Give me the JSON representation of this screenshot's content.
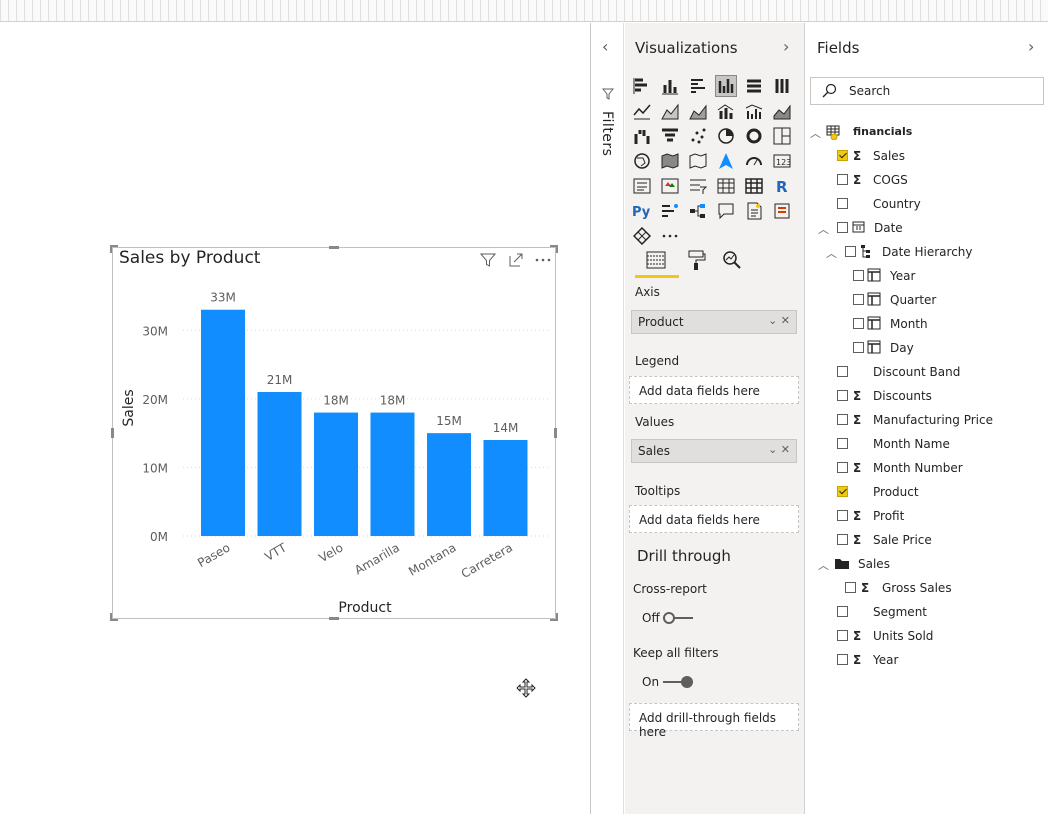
{
  "chart_visual": {
    "title": "Sales by Product",
    "header_icons": [
      "filter-icon",
      "focus-mode-icon",
      "more-options-icon"
    ]
  },
  "chart_data": {
    "type": "bar",
    "title": "Sales by Product",
    "xlabel": "Product",
    "ylabel": "Sales",
    "categories": [
      "Paseo",
      "VTT",
      "Velo",
      "Amarilla",
      "Montana",
      "Carretera"
    ],
    "values": [
      33,
      21,
      18,
      18,
      15,
      14
    ],
    "data_labels": [
      "33M",
      "21M",
      "18M",
      "18M",
      "15M",
      "14M"
    ],
    "y_ticks": [
      "0M",
      "10M",
      "20M",
      "30M"
    ],
    "y_tick_values": [
      0,
      10,
      20,
      30
    ],
    "ylim": [
      0,
      35
    ],
    "bar_color": "#118DFF",
    "grid": true
  },
  "filters": {
    "label": "Filters"
  },
  "visualizations": {
    "title": "Visualizations",
    "selected_visual": "clustered-column-chart",
    "tabs": [
      "fields-tab",
      "format-tab",
      "analytics-tab"
    ],
    "wells": {
      "axis_label": "Axis",
      "axis_value": "Product",
      "legend_label": "Legend",
      "legend_placeholder": "Add data fields here",
      "values_label": "Values",
      "values_value": "Sales",
      "tooltips_label": "Tooltips",
      "tooltips_placeholder": "Add data fields here"
    },
    "drill_through": {
      "title": "Drill through",
      "cross_report_label": "Cross-report",
      "cross_report_state": "Off",
      "keep_filters_label": "Keep all filters",
      "keep_filters_state": "On",
      "placeholder": "Add drill-through fields here"
    }
  },
  "fields": {
    "title": "Fields",
    "search_placeholder": "Search",
    "items": [
      {
        "label": "financials",
        "checked": false,
        "sigma": false,
        "kind": "table"
      },
      {
        "label": "Sales",
        "checked": true,
        "sigma": true
      },
      {
        "label": "COGS",
        "checked": false,
        "sigma": true
      },
      {
        "label": "Country",
        "checked": false,
        "sigma": false
      },
      {
        "label": "Date",
        "checked": false,
        "sigma": false,
        "kind": "date"
      },
      {
        "label": "Date Hierarchy",
        "checked": false,
        "sigma": false,
        "kind": "hierarchy"
      },
      {
        "label": "Year",
        "checked": false,
        "kind": "level"
      },
      {
        "label": "Quarter",
        "checked": false,
        "kind": "level"
      },
      {
        "label": "Month",
        "checked": false,
        "kind": "level"
      },
      {
        "label": "Day",
        "checked": false,
        "kind": "level"
      },
      {
        "label": "Discount Band",
        "checked": false,
        "sigma": false
      },
      {
        "label": "Discounts",
        "checked": false,
        "sigma": true
      },
      {
        "label": "Manufacturing Price",
        "checked": false,
        "sigma": true
      },
      {
        "label": "Month Name",
        "checked": false,
        "sigma": false
      },
      {
        "label": "Month Number",
        "checked": false,
        "sigma": true
      },
      {
        "label": "Product",
        "checked": true,
        "sigma": false
      },
      {
        "label": "Profit",
        "checked": false,
        "sigma": true
      },
      {
        "label": "Sale Price",
        "checked": false,
        "sigma": true
      },
      {
        "label": "Sales",
        "checked": false,
        "kind": "folder"
      },
      {
        "label": "Gross Sales",
        "checked": false,
        "sigma": true,
        "kind": "folder-item"
      },
      {
        "label": "Segment",
        "checked": false,
        "sigma": false
      },
      {
        "label": "Units Sold",
        "checked": false,
        "sigma": true
      },
      {
        "label": "Year",
        "checked": false,
        "sigma": true
      }
    ]
  },
  "colors": {
    "accent_yellow": "#F2C811",
    "bar_blue": "#118DFF",
    "pane_bg": "#F3F2F1"
  }
}
